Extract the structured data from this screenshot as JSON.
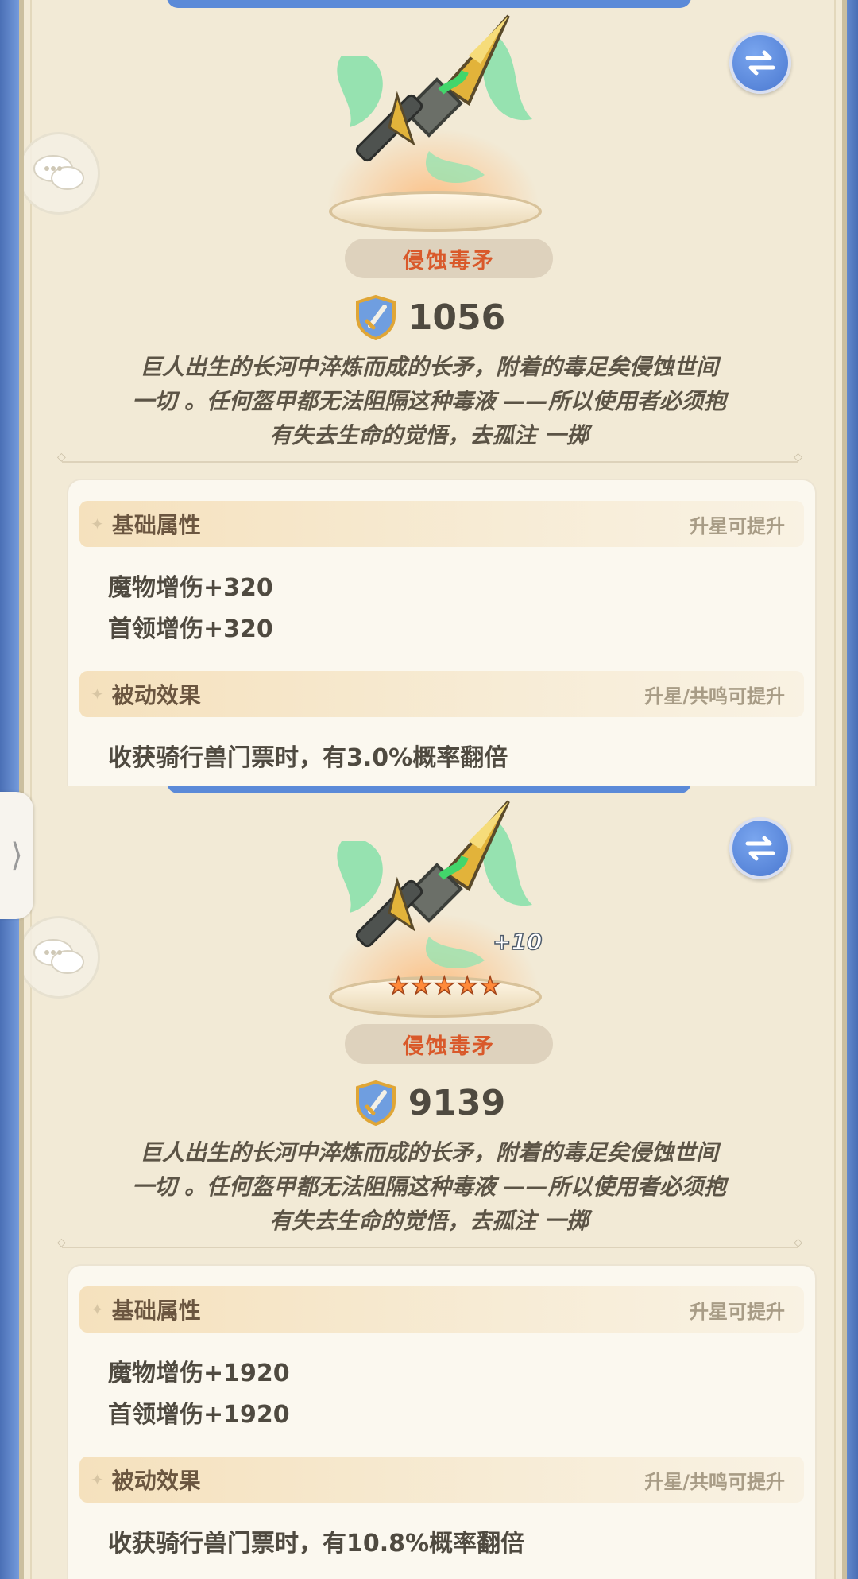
{
  "panels": [
    {
      "weapon_name": "侵蚀毒矛",
      "power": "1056",
      "enhance_level": "",
      "stars": 0,
      "description": [
        "巨人出生的长河中淬炼而成的长矛，附着的毒足矣侵蚀世间",
        "一切 。任何盔甲都无法阻隔这种毒液 ——所以使用者必须抱",
        "有失去生命的觉悟，去孤注 一掷"
      ],
      "basic": {
        "title": "基础属性",
        "hint": "升星可提升",
        "stats": [
          "魔物增伤+320",
          "首领增伤+320"
        ]
      },
      "passive": {
        "title": "被动效果",
        "hint": "升星/共鸣可提升",
        "text": "收获骑行兽门票时，有3.0%概率翻倍"
      }
    },
    {
      "weapon_name": "侵蚀毒矛",
      "power": "9139",
      "enhance_level": "+10",
      "stars": 5,
      "description": [
        "巨人出生的长河中淬炼而成的长矛，附着的毒足矣侵蚀世间",
        "一切 。任何盔甲都无法阻隔这种毒液 ——所以使用者必须抱",
        "有失去生命的觉悟，去孤注 一掷"
      ],
      "basic": {
        "title": "基础属性",
        "hint": "升星可提升",
        "stats": [
          "魔物增伤+1920",
          "首领增伤+1920"
        ]
      },
      "passive": {
        "title": "被动效果",
        "hint": "升星/共鸣可提升",
        "text": "收获骑行兽门票时，有10.8%概率翻倍"
      }
    }
  ],
  "edge_tab_glyph": "⟩",
  "colors": {
    "accent_name": "#d9592a",
    "swap_button": "#5b8ad8",
    "panel_bg": "#f2ead6"
  }
}
